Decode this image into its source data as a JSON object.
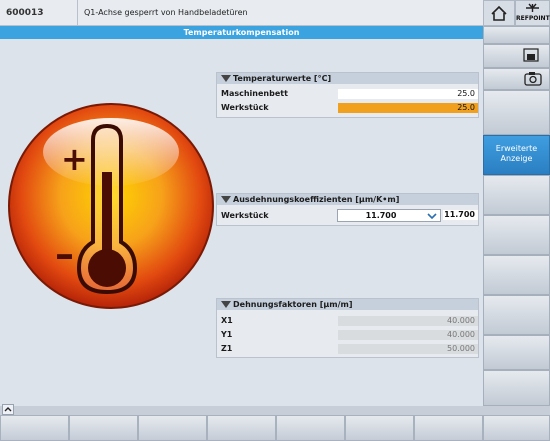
{
  "header": {
    "alarm_code": "600013",
    "alarm_text": "Q1-Achse gesperrt von Handbeladetüren"
  },
  "title": "Temperaturkompensation",
  "right_panel": {
    "refpoint_label": "REFPOINT",
    "active_softkey_label_line1": "Erweiterte",
    "active_softkey_label_line2": "Anzeige"
  },
  "temperature_values": {
    "title": "Temperaturwerte [°C]",
    "rows": [
      {
        "label": "Maschinenbett",
        "value": "25.0"
      },
      {
        "label": "Werkstück",
        "value": "25.0"
      }
    ]
  },
  "expansion": {
    "title": "Ausdehnungskoeffizienten [µm/K•m]",
    "row_label": "Werkstück",
    "select_value": "11.700",
    "value": "11.700"
  },
  "strain": {
    "title": "Dehnungsfaktoren [µm/m]",
    "rows": [
      {
        "label": "X1",
        "value": "40.000"
      },
      {
        "label": "Y1",
        "value": "40.000"
      },
      {
        "label": "Z1",
        "value": "50.000"
      }
    ]
  },
  "thermometer": {
    "plus_sign": "+",
    "minus_sign": "–"
  },
  "colors": {
    "title_bar": "#3aa3e0",
    "highlight": "#f0a01c",
    "active_softkey": "#2a7fc2"
  }
}
